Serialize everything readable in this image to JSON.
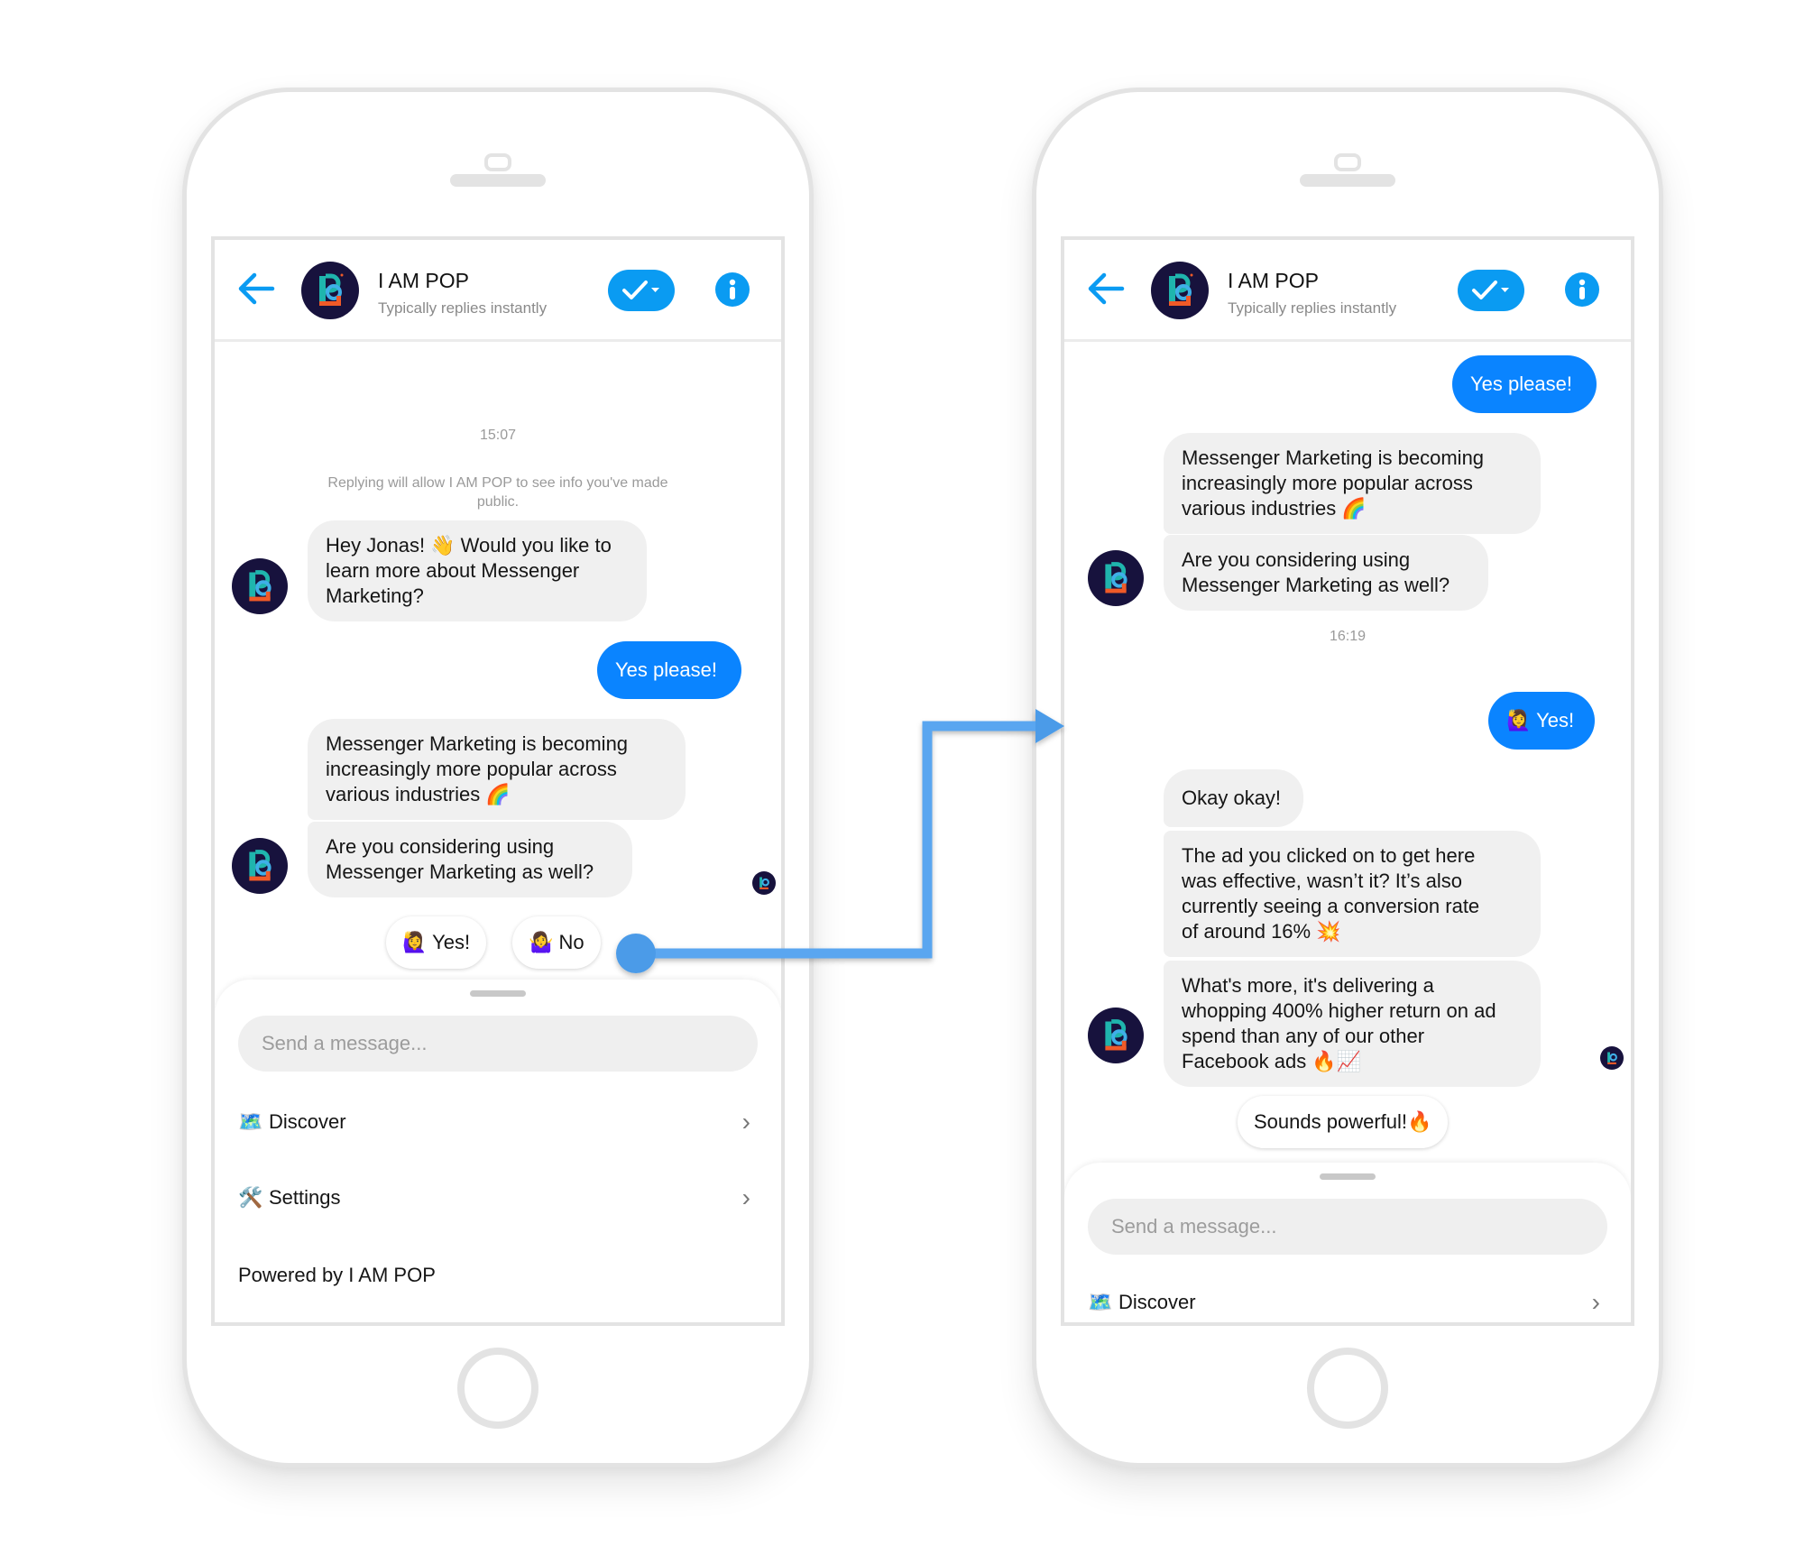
{
  "colors": {
    "accent": "#0a84ff",
    "header_icon_blue": "#0a9bf2",
    "bubble_gray": "#f0f0f0",
    "arrow_blue": "#4c9be8",
    "avatar_bg": "#17123d"
  },
  "left_phone": {
    "header": {
      "back_icon": "arrow-left-icon",
      "title": "I AM POP",
      "subtitle": "Typically replies instantly",
      "check_icon": "check-dropdown-icon",
      "info_icon": "info-icon"
    },
    "timestamp": "15:07",
    "privacy_notice": "Replying will allow I AM POP to see info you've made\npublic.",
    "messages": [
      {
        "from": "bot",
        "text": "Hey Jonas! 👋 Would you like to\nlearn more about Messenger\nMarketing?"
      },
      {
        "from": "user",
        "text": "Yes please!"
      },
      {
        "from": "bot",
        "text": "Messenger Marketing is becoming\nincreasingly more popular across\nvarious industries 🌈"
      },
      {
        "from": "bot",
        "text": "Are you considering using\nMessenger Marketing as well?"
      }
    ],
    "quick_replies": [
      "🙋‍♀️ Yes!",
      "🤷‍♀️ No"
    ],
    "composer": {
      "placeholder": "Send a message...",
      "menu": [
        {
          "icon": "🗺️",
          "label": "Discover"
        },
        {
          "icon": "🛠️",
          "label": "Settings"
        }
      ],
      "powered_by": "Powered by I AM POP"
    }
  },
  "right_phone": {
    "header": {
      "back_icon": "arrow-left-icon",
      "title": "I AM POP",
      "subtitle": "Typically replies instantly",
      "check_icon": "check-dropdown-icon",
      "info_icon": "info-icon"
    },
    "messages_before": [
      {
        "from": "user",
        "text": "Yes please!"
      },
      {
        "from": "bot",
        "text": "Messenger Marketing is becoming\nincreasingly more popular across\nvarious industries 🌈"
      },
      {
        "from": "bot",
        "text": "Are you considering using\nMessenger Marketing as well?"
      }
    ],
    "timestamp": "16:19",
    "messages_after": [
      {
        "from": "user",
        "text": "🙋‍♀️ Yes!"
      },
      {
        "from": "bot",
        "text": "Okay okay!"
      },
      {
        "from": "bot",
        "text": "The ad you clicked on to get here\nwas effective, wasn’t it? It’s also\ncurrently seeing a conversion rate\nof around 16% 💥"
      },
      {
        "from": "bot",
        "text": "What's more, it's delivering a\nwhopping 400% higher return on ad\nspend than any of our other\nFacebook ads 🔥📈"
      }
    ],
    "quick_replies": [
      "Sounds powerful!🔥"
    ],
    "composer": {
      "placeholder": "Send a message...",
      "menu": [
        {
          "icon": "🗺️",
          "label": "Discover"
        }
      ]
    }
  }
}
